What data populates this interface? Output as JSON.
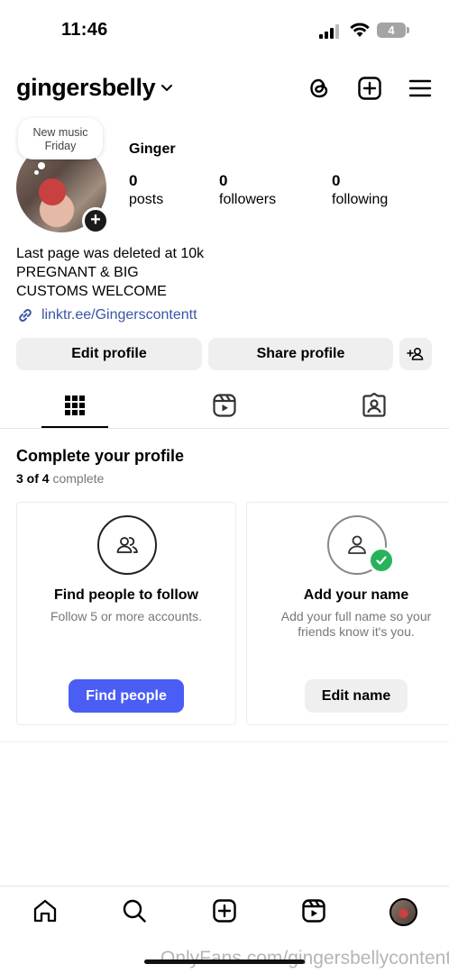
{
  "status_bar": {
    "time": "11:46",
    "battery": "4"
  },
  "header": {
    "username": "gingersbelly"
  },
  "profile": {
    "note_line1": "New music",
    "note_line2": "Friday",
    "display_name": "Ginger",
    "stats": {
      "posts": {
        "value": "0",
        "label": "posts"
      },
      "followers": {
        "value": "0",
        "label": "followers"
      },
      "following": {
        "value": "0",
        "label": "following"
      }
    },
    "bio": [
      "Last page was deleted at 10k",
      "PREGNANT & BIG",
      "CUSTOMS WELCOME"
    ],
    "link": "linktr.ee/Gingerscontentt"
  },
  "actions": {
    "edit_profile": "Edit profile",
    "share_profile": "Share profile"
  },
  "complete_profile": {
    "title": "Complete your profile",
    "progress_count": "3 of 4",
    "progress_word": "complete",
    "cards": [
      {
        "title": "Find people to follow",
        "desc": "Follow 5 or more accounts.",
        "button": "Find people"
      },
      {
        "title": "Add your name",
        "desc": "Add your full name so your friends know it's you.",
        "button": "Edit name"
      }
    ]
  },
  "watermark": "OnlyFans.com/gingersbellycontent",
  "colors": {
    "link": "#3b55a5",
    "primary_button": "#4a5df5",
    "check": "#27b35a"
  }
}
